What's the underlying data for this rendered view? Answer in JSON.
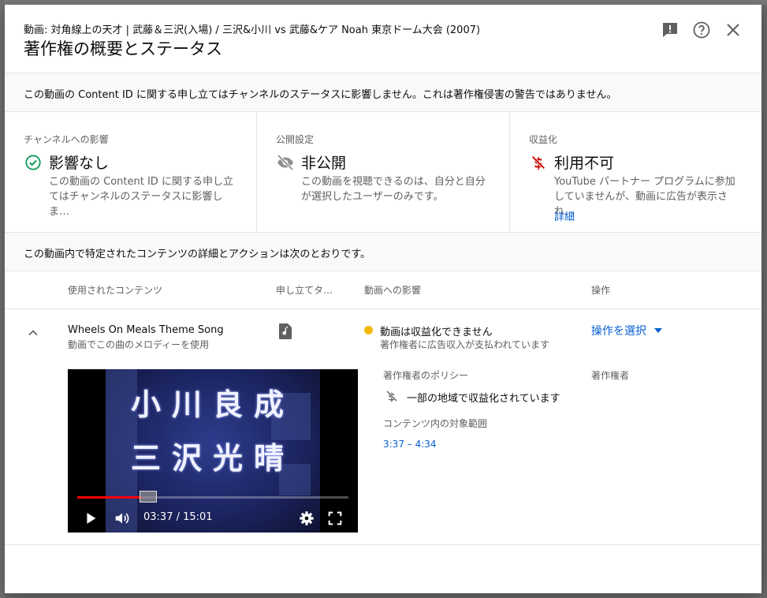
{
  "header": {
    "video_title": "動画: 対角線上の天才 | 武藤＆三沢(入場) / 三沢&小川 vs 武藤&ケア Noah 東京ドーム大会 (2007)",
    "dialog_title": "著作権の概要とステータス",
    "icons": [
      "feedback-icon",
      "help-icon",
      "close-icon"
    ]
  },
  "banner": {
    "text": "この動画の Content ID に関する申し立てはチャンネルのステータスに影響しません。これは著作権侵害の警告ではありません。"
  },
  "status": {
    "channel": {
      "label": "チャンネルへの影響",
      "value": "影響なし",
      "desc": "この動画の Content ID に関する申し立てはチャンネルのステータスに影響しま…",
      "icon": "check-circle-icon",
      "color": "#0f9d58"
    },
    "visibility": {
      "label": "公開設定",
      "value": "非公開",
      "desc": "この動画を視聴できるのは、自分と自分が選択したユーザーのみです。",
      "icon": "eye-off-icon"
    },
    "monetization": {
      "label": "収益化",
      "value": "利用不可",
      "desc": "YouTube パートナー プログラムに参加していませんが、動画に広告が表示され…",
      "link": "詳細",
      "icon": "no-money-icon",
      "color": "#cc0000"
    }
  },
  "section": {
    "text": "この動画内で特定されたコンテンツの詳細とアクションは次のとおりです。"
  },
  "table": {
    "headers": {
      "content": "使用されたコンテンツ",
      "claim_type": "申し立てタ…",
      "impact": "動画への影響",
      "action": "操作"
    },
    "row": {
      "title": "Wheels On Meals Theme Song",
      "subtitle": "動画でこの曲のメロディーを使用",
      "type_icon": "music-note-icon",
      "impact_title": "動画は収益化できません",
      "impact_sub": "著作権者に広告収入が支払われています",
      "impact_color": "#f2b90c",
      "action_label": "操作を選択"
    }
  },
  "player": {
    "caption_line1": "小川良成",
    "caption_line2": "三沢光晴",
    "time": "03:37 / 15:01",
    "progress": 0.24
  },
  "details": {
    "policy_label": "著作権者のポリシー",
    "policy_text": "一部の地域で収益化されています",
    "range_label": "コンテンツ内の対象範囲",
    "range_value": "3:37 – 4:34",
    "owner_label": "著作権者"
  }
}
